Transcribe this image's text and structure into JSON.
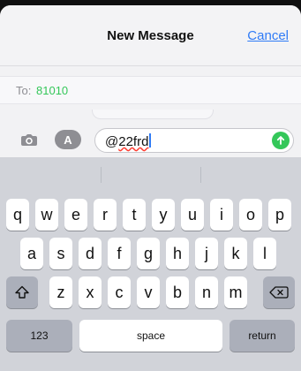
{
  "header": {
    "title": "New Message",
    "cancel_label": "Cancel"
  },
  "recipient": {
    "label": "To:",
    "value": "81010"
  },
  "compose": {
    "text_prefix": "@",
    "text_spell": "22frd"
  },
  "keyboard": {
    "row1": [
      "q",
      "w",
      "e",
      "r",
      "t",
      "y",
      "u",
      "i",
      "o",
      "p"
    ],
    "row2": [
      "a",
      "s",
      "d",
      "f",
      "g",
      "h",
      "j",
      "k",
      "l"
    ],
    "row3": [
      "z",
      "x",
      "c",
      "v",
      "b",
      "n",
      "m"
    ],
    "numbers_label": "123",
    "space_label": "space",
    "return_label": "return",
    "icons": {
      "shift": "shift-arrow-icon",
      "delete": "delete-backspace-icon"
    }
  },
  "colors": {
    "accent": "#2f7bf6",
    "send": "#34c759",
    "recipient": "#34c759"
  }
}
